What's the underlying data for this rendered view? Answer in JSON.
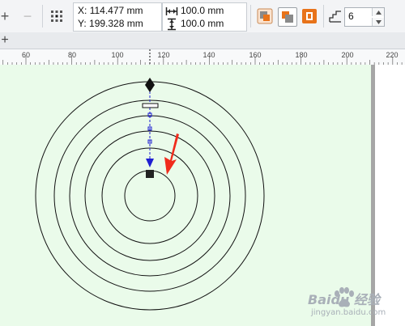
{
  "propbar": {
    "x_label": "X:",
    "x_value": "114.477 mm",
    "y_label": "Y:",
    "y_value": "199.328 mm",
    "width_value": "100.0 mm",
    "height_value": "100.0 mm",
    "copies_value": "6",
    "accent_color": "#e8731a"
  },
  "ruler": {
    "ticks": [
      "60",
      "80",
      "100",
      "120",
      "140",
      "160",
      "180",
      "200",
      "220"
    ]
  },
  "canvas": {
    "background_color": "#eafbea",
    "ring_count": 6,
    "arrow_color": "#f02b1c",
    "guide_color": "#1f1fd1"
  },
  "watermark": {
    "line1": "Baidu 经验",
    "line2": "jingyan.baidu.com"
  }
}
